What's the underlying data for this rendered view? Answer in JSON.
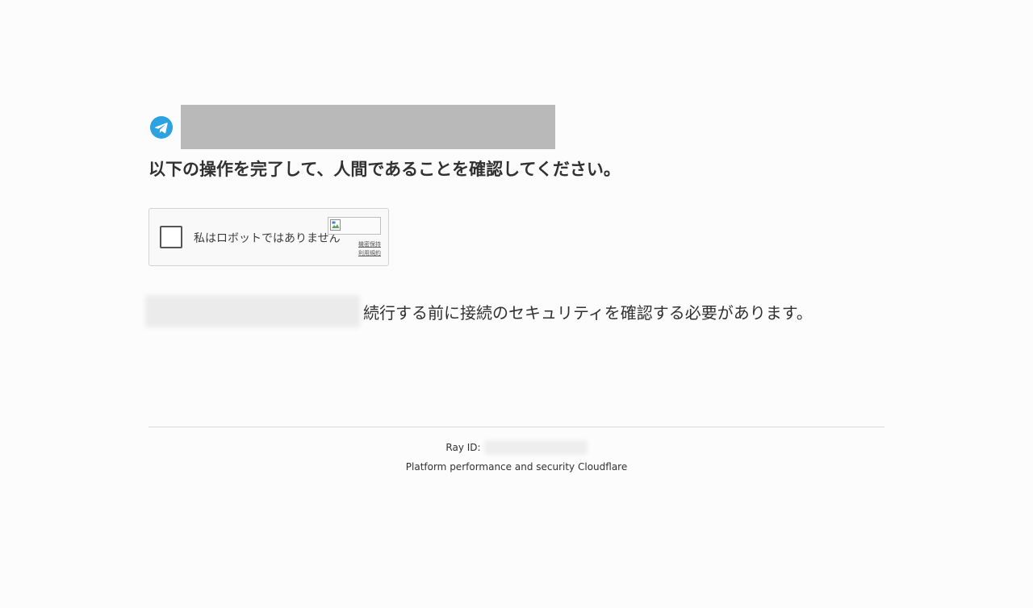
{
  "header": {
    "icon": "telegram-icon",
    "title_redacted": true
  },
  "heading": "以下の操作を完了して、人間であることを確認してください。",
  "captcha": {
    "checkbox_label": "私はロボットではありません",
    "privacy_link": "機密保持",
    "terms_link": "利用規約",
    "logo_icon": "broken-image-icon"
  },
  "info": {
    "domain_redacted": true,
    "text": "続行する前に接続のセキュリティを確認する必要があります。"
  },
  "footer": {
    "ray_label": "Ray ID:",
    "ray_value_redacted": true,
    "performance_text": "Platform performance and security",
    "brand": "Cloudflare"
  },
  "colors": {
    "background": "#fcfcfc",
    "text": "#313131",
    "telegram_blue": "#2aa3e0",
    "redaction_gray": "#b9b9b9"
  }
}
